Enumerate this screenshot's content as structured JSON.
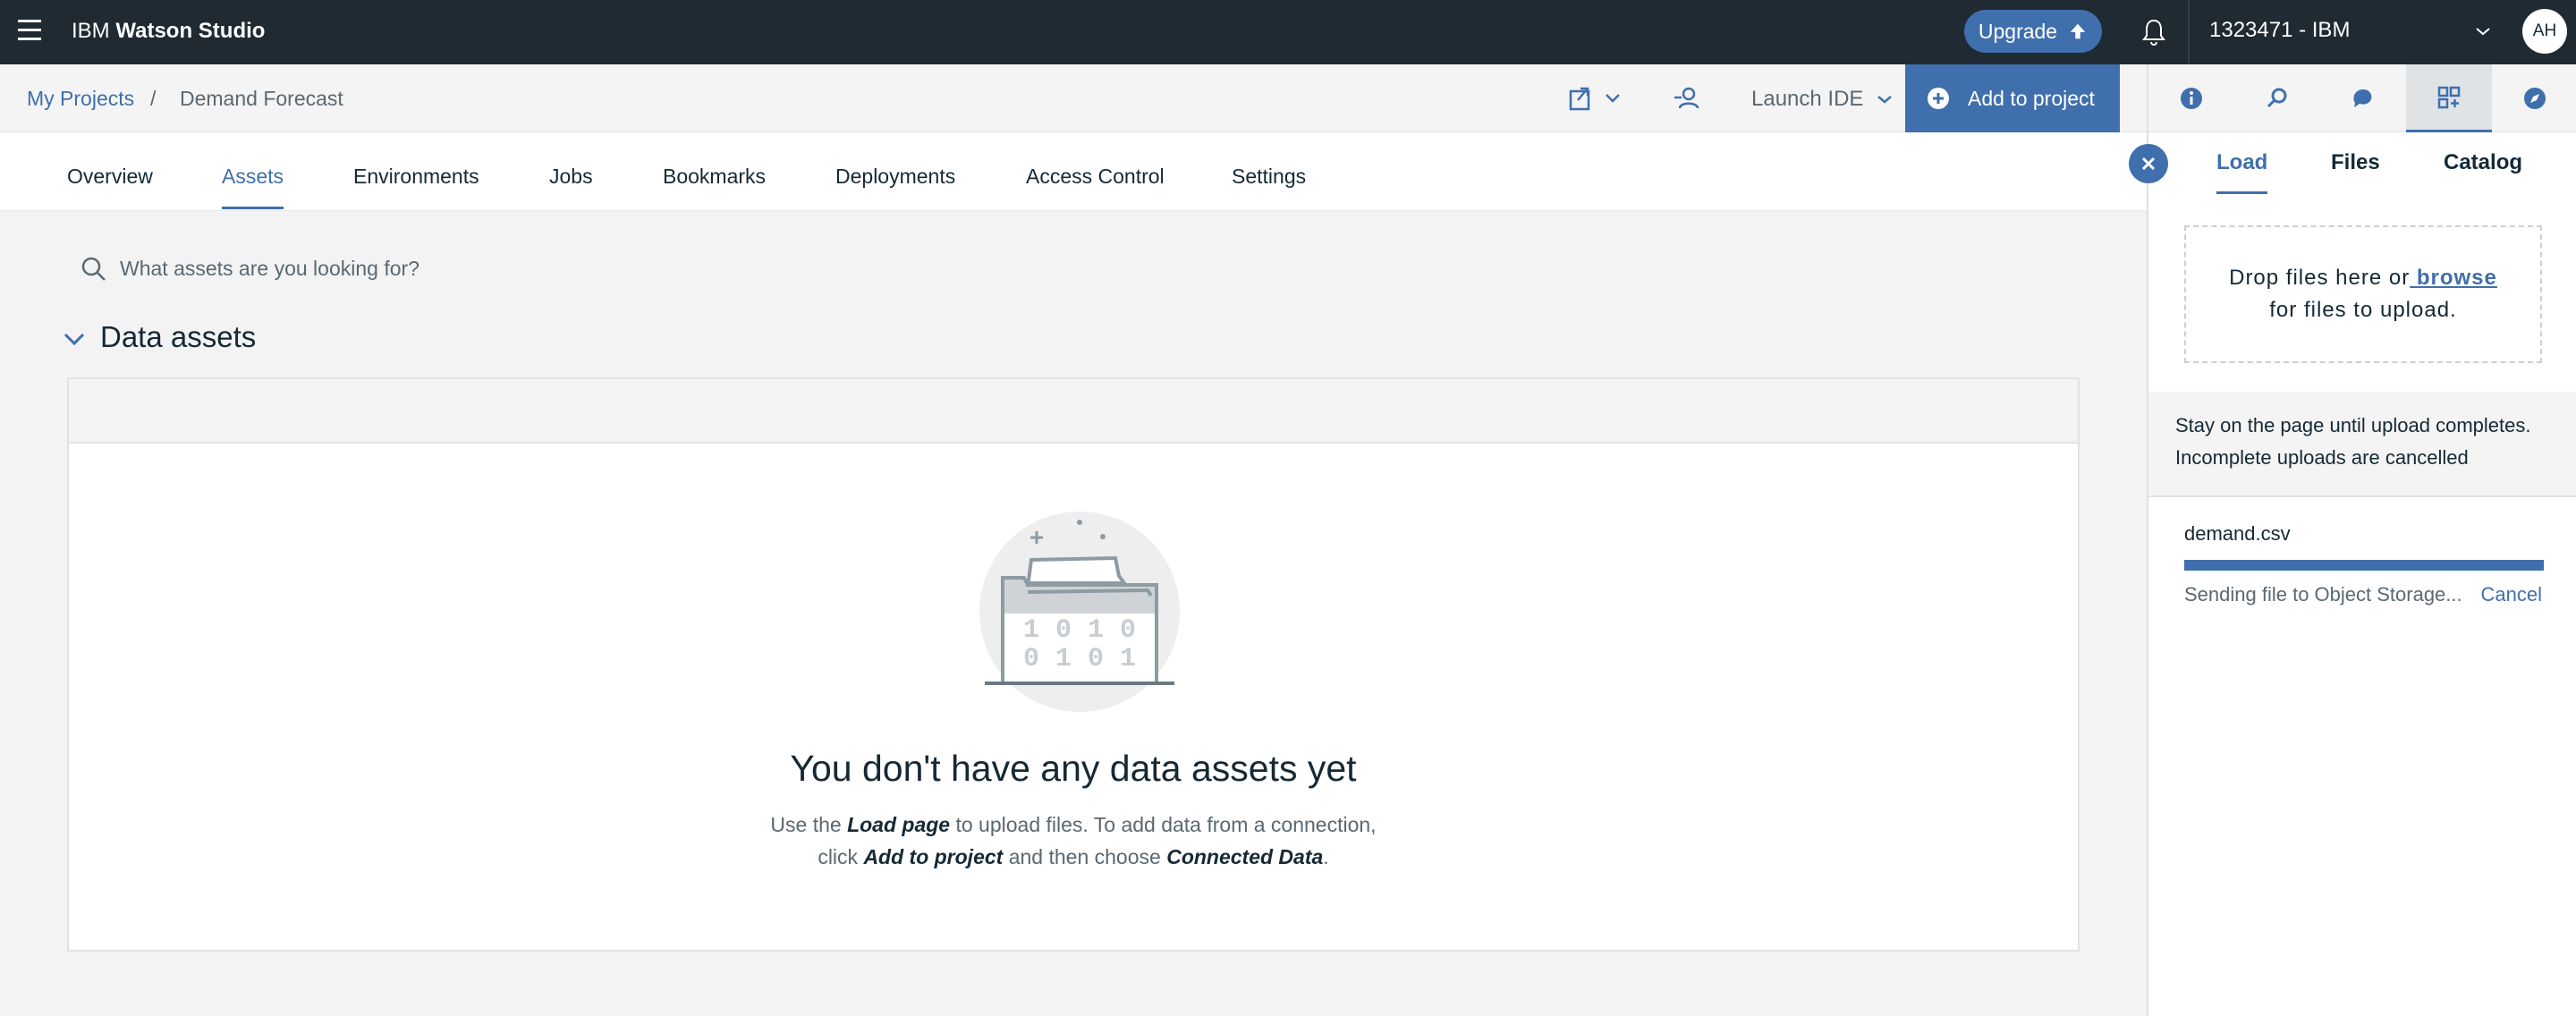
{
  "topbar": {
    "brand_prefix": "IBM",
    "brand_name": "Watson Studio",
    "upgrade_label": "Upgrade",
    "account_label": "1323471 - IBM",
    "avatar_initials": "AH"
  },
  "breadcrumb": {
    "parent": "My Projects",
    "separator": "/",
    "current": "Demand Forecast"
  },
  "actions": {
    "launch_ide_label": "Launch IDE",
    "add_to_project_label": "Add to project"
  },
  "tabs": [
    "Overview",
    "Assets",
    "Environments",
    "Jobs",
    "Bookmarks",
    "Deployments",
    "Access Control",
    "Settings"
  ],
  "active_tab": "Assets",
  "search": {
    "placeholder": "What assets are you looking for?"
  },
  "section": {
    "title": "Data assets"
  },
  "empty_state": {
    "title": "You don't have any data assets yet",
    "line1_pre": "Use the ",
    "line1_bold": "Load page",
    "line1_post": " to upload files. To add data from a connection,",
    "line2_pre": "click ",
    "line2_bold1": "Add to project",
    "line2_mid": " and then choose ",
    "line2_bold2": "Connected Data",
    "line2_post": ".",
    "illustration_digits_row1": "1 0 1 0",
    "illustration_digits_row2": "0 1 0 1"
  },
  "side_panel": {
    "tabs": [
      "Load",
      "Files",
      "Catalog"
    ],
    "active_tab": "Load",
    "dropzone_text_pre": "Drop files here or",
    "dropzone_link": " browse",
    "dropzone_text_post": "for files to upload.",
    "notice_line1": "Stay on the page until upload completes.",
    "notice_line2": "Incomplete uploads are cancelled",
    "upload": {
      "file_name": "demand.csv",
      "progress_fraction": 1.0,
      "status": "Sending file to Object Storage...",
      "cancel_label": "Cancel"
    }
  },
  "colors": {
    "topbar_bg": "#1f2a33",
    "accent": "#3f6fad",
    "text": "#152935",
    "muted": "#5a6872"
  }
}
